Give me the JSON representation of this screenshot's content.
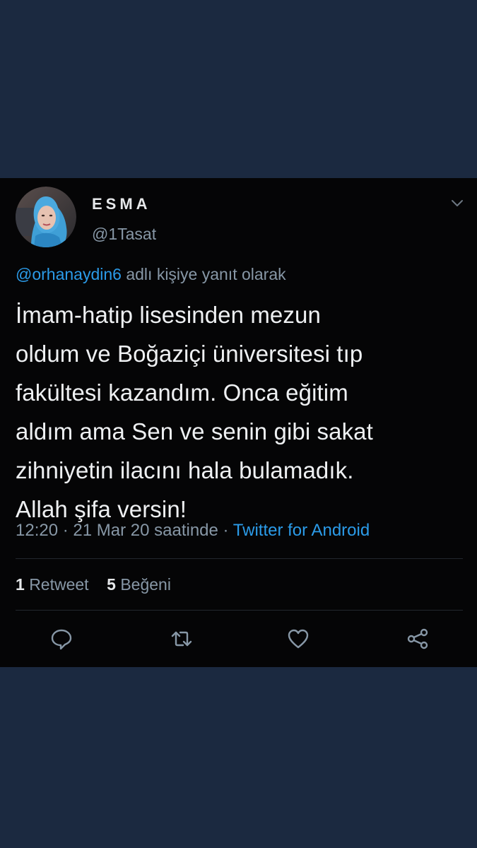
{
  "tweet": {
    "display_name": "ESMA",
    "handle": "@1Tasat",
    "reply_to_mention": "@orhanaydin6",
    "reply_to_suffix": "adlı kişiye yanıt olarak",
    "text_lines": [
      "İmam-hatip lisesinden mezun",
      "oldum ve Boğaziçi üniversitesi tıp",
      "fakültesi kazandım. Onca eğitim",
      "aldım ama Sen ve senin gibi sakat",
      "zihniyetin ilacını hala bulamadık.",
      "Allah şifa versin!"
    ],
    "time": "12:20",
    "date_text": "21 Mar 20 saatinde",
    "separator": "·",
    "source": "Twitter for Android",
    "retweet_count": "1",
    "retweet_label": "Retweet",
    "like_count": "5",
    "like_label": "Beğeni"
  },
  "icons": {
    "caret": "chevron-down-icon",
    "reply": "reply-icon",
    "retweet": "retweet-icon",
    "like": "heart-icon",
    "share": "share-icon"
  },
  "colors": {
    "background": "#1b2940",
    "card": "#050506",
    "accent": "#2b9be8",
    "secondary_text": "#8797a6",
    "primary_text": "#eef0f2"
  }
}
